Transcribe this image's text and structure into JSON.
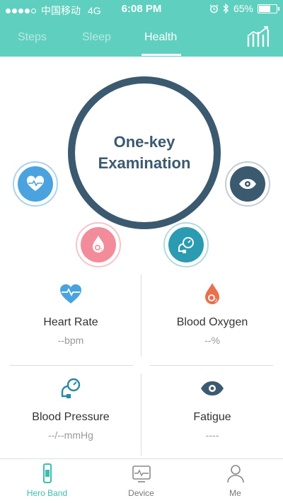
{
  "status": {
    "carrier": "中国移动",
    "network": "4G",
    "time": "6:08 PM",
    "battery_percent": "65%",
    "battery_level": 0.65
  },
  "tabs": [
    {
      "label": "Steps",
      "active": false
    },
    {
      "label": "Sleep",
      "active": false
    },
    {
      "label": "Health",
      "active": true
    }
  ],
  "main_button": {
    "label": "One-key Examination"
  },
  "colors": {
    "header": "#5fcfbf",
    "dark": "#3c5a6f",
    "heart_blue": "#4aa3df",
    "oxygen_pink": "#f28b9a",
    "pressure_teal": "#2a9bb0",
    "accent": "#3dbdb0"
  },
  "metrics": [
    {
      "icon": "heart-rate-icon",
      "label": "Heart Rate",
      "value": "--",
      "unit": "bpm"
    },
    {
      "icon": "blood-oxygen-icon",
      "label": "Blood Oxygen",
      "value": "--",
      "unit": "%"
    },
    {
      "icon": "blood-pressure-icon",
      "label": "Blood Pressure",
      "value": "--/--",
      "unit": "mmHg"
    },
    {
      "icon": "fatigue-eye-icon",
      "label": "Fatigue",
      "value": "----",
      "unit": ""
    }
  ],
  "bottom_nav": [
    {
      "label": "Hero Band",
      "active": true
    },
    {
      "label": "Device",
      "active": false
    },
    {
      "label": "Me",
      "active": false
    }
  ]
}
